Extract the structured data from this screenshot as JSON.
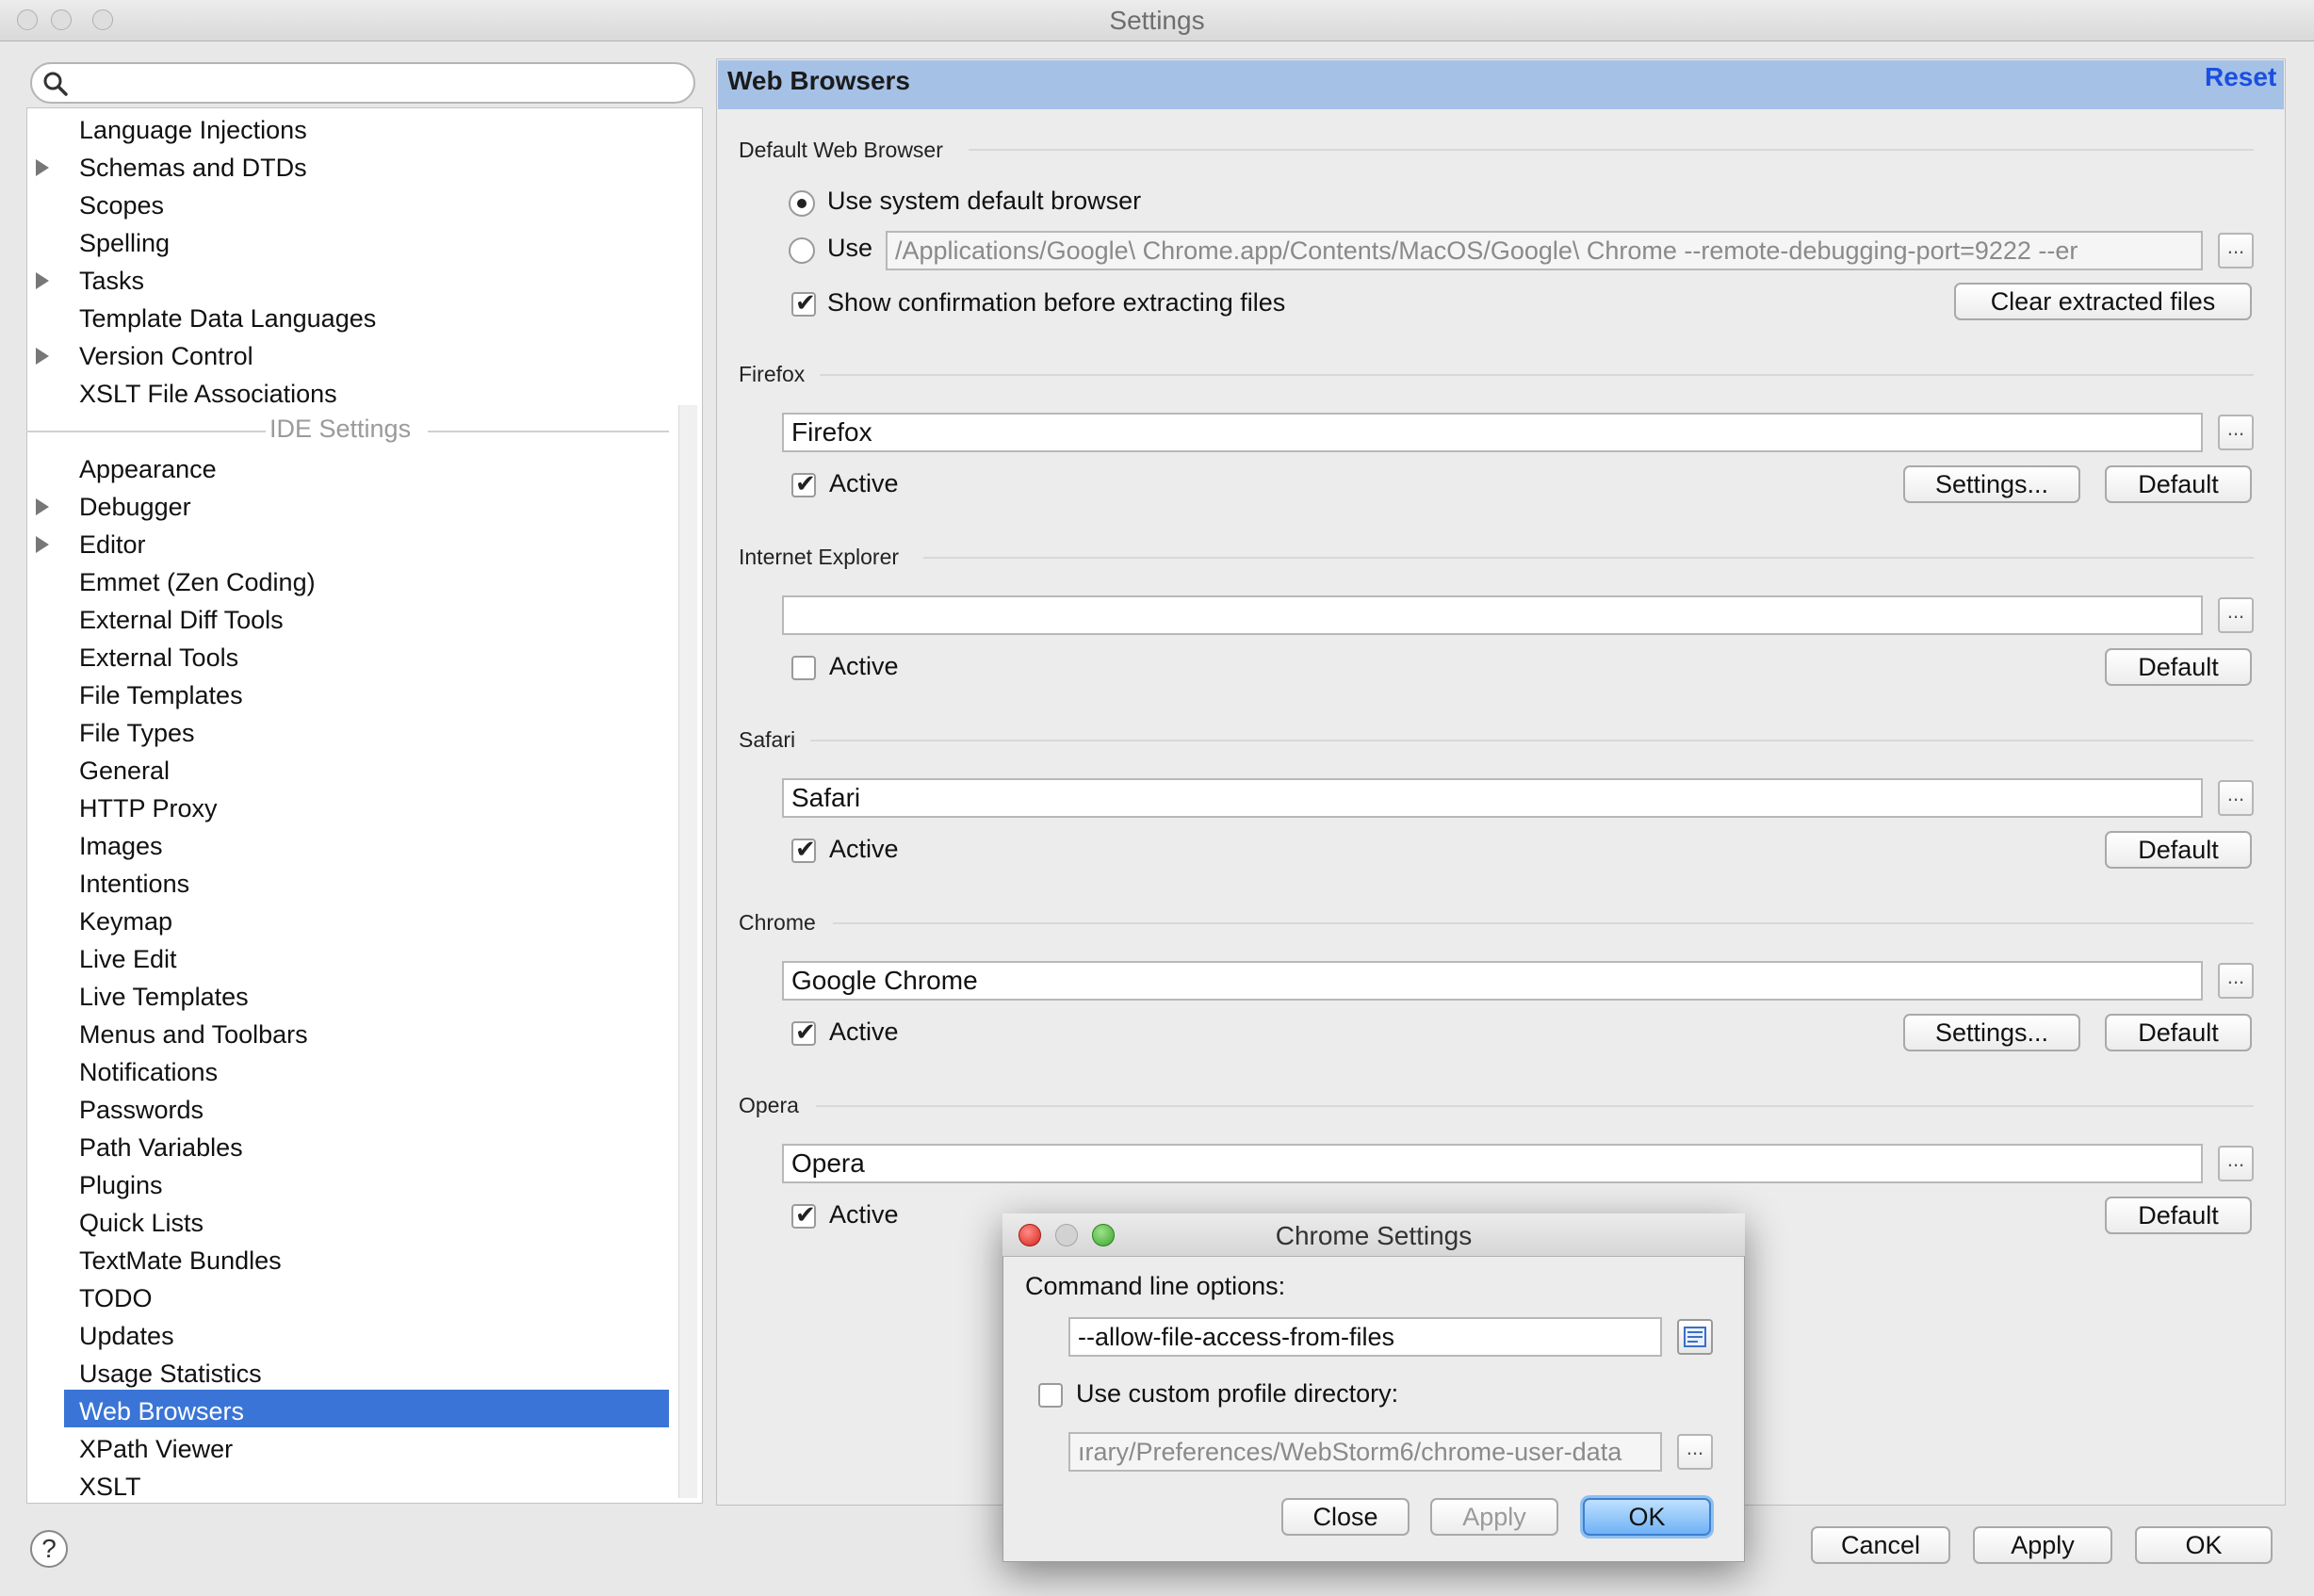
{
  "window": {
    "title": "Settings"
  },
  "search": {
    "placeholder": ""
  },
  "tree": {
    "items_before": [
      {
        "label": "Language Injections",
        "expandable": false
      },
      {
        "label": "Schemas and DTDs",
        "expandable": true
      },
      {
        "label": "Scopes",
        "expandable": false
      },
      {
        "label": "Spelling",
        "expandable": false
      },
      {
        "label": "Tasks",
        "expandable": true
      },
      {
        "label": "Template Data Languages",
        "expandable": false
      },
      {
        "label": "Version Control",
        "expandable": true
      },
      {
        "label": "XSLT File Associations",
        "expandable": false
      }
    ],
    "group_label": "IDE Settings",
    "items_after": [
      {
        "label": "Appearance",
        "expandable": false
      },
      {
        "label": "Debugger",
        "expandable": true
      },
      {
        "label": "Editor",
        "expandable": true
      },
      {
        "label": "Emmet (Zen Coding)",
        "expandable": false
      },
      {
        "label": "External Diff Tools",
        "expandable": false
      },
      {
        "label": "External Tools",
        "expandable": false
      },
      {
        "label": "File Templates",
        "expandable": false
      },
      {
        "label": "File Types",
        "expandable": false
      },
      {
        "label": "General",
        "expandable": false
      },
      {
        "label": "HTTP Proxy",
        "expandable": false
      },
      {
        "label": "Images",
        "expandable": false
      },
      {
        "label": "Intentions",
        "expandable": false
      },
      {
        "label": "Keymap",
        "expandable": false
      },
      {
        "label": "Live Edit",
        "expandable": false
      },
      {
        "label": "Live Templates",
        "expandable": false
      },
      {
        "label": "Menus and Toolbars",
        "expandable": false
      },
      {
        "label": "Notifications",
        "expandable": false
      },
      {
        "label": "Passwords",
        "expandable": false
      },
      {
        "label": "Path Variables",
        "expandable": false
      },
      {
        "label": "Plugins",
        "expandable": false
      },
      {
        "label": "Quick Lists",
        "expandable": false
      },
      {
        "label": "TextMate Bundles",
        "expandable": false
      },
      {
        "label": "TODO",
        "expandable": false
      },
      {
        "label": "Updates",
        "expandable": false
      },
      {
        "label": "Usage Statistics",
        "expandable": false
      },
      {
        "label": "Web Browsers",
        "expandable": false,
        "selected": true
      },
      {
        "label": "XPath Viewer",
        "expandable": false
      },
      {
        "label": "XSLT",
        "expandable": false
      }
    ]
  },
  "panel": {
    "title": "Web Browsers",
    "reset": "Reset",
    "default_browser": {
      "section": "Default Web Browser",
      "use_system": "Use system default browser",
      "use": "Use",
      "use_path": "/Applications/Google\\ Chrome.app/Contents/MacOS/Google\\ Chrome --remote-debugging-port=9222 --er",
      "show_confirmation": "Show confirmation before extracting files",
      "clear_button": "Clear extracted files"
    },
    "browsers": {
      "firefox": {
        "section": "Firefox",
        "path": "Firefox",
        "active": true,
        "active_label": "Active",
        "settings": "Settings...",
        "default": "Default"
      },
      "ie": {
        "section": "Internet Explorer",
        "path": "",
        "active": false,
        "active_label": "Active",
        "default": "Default"
      },
      "safari": {
        "section": "Safari",
        "path": "Safari",
        "active": true,
        "active_label": "Active",
        "default": "Default"
      },
      "chrome": {
        "section": "Chrome",
        "path": "Google Chrome",
        "active": true,
        "active_label": "Active",
        "settings": "Settings...",
        "default": "Default"
      },
      "opera": {
        "section": "Opera",
        "path": "Opera",
        "active": true,
        "active_label": "Active",
        "default": "Default"
      }
    },
    "ellipsis": "..."
  },
  "footer": {
    "help": "?",
    "cancel": "Cancel",
    "apply": "Apply",
    "ok": "OK"
  },
  "dialog": {
    "title": "Chrome Settings",
    "cmd_label": "Command line options:",
    "cmd_value": "--allow-file-access-from-files",
    "custom_profile_label": "Use custom profile directory:",
    "profile_path": "ırary/Preferences/WebStorm6/chrome-user-data",
    "ellipsis": "...",
    "close": "Close",
    "apply": "Apply",
    "ok": "OK"
  }
}
